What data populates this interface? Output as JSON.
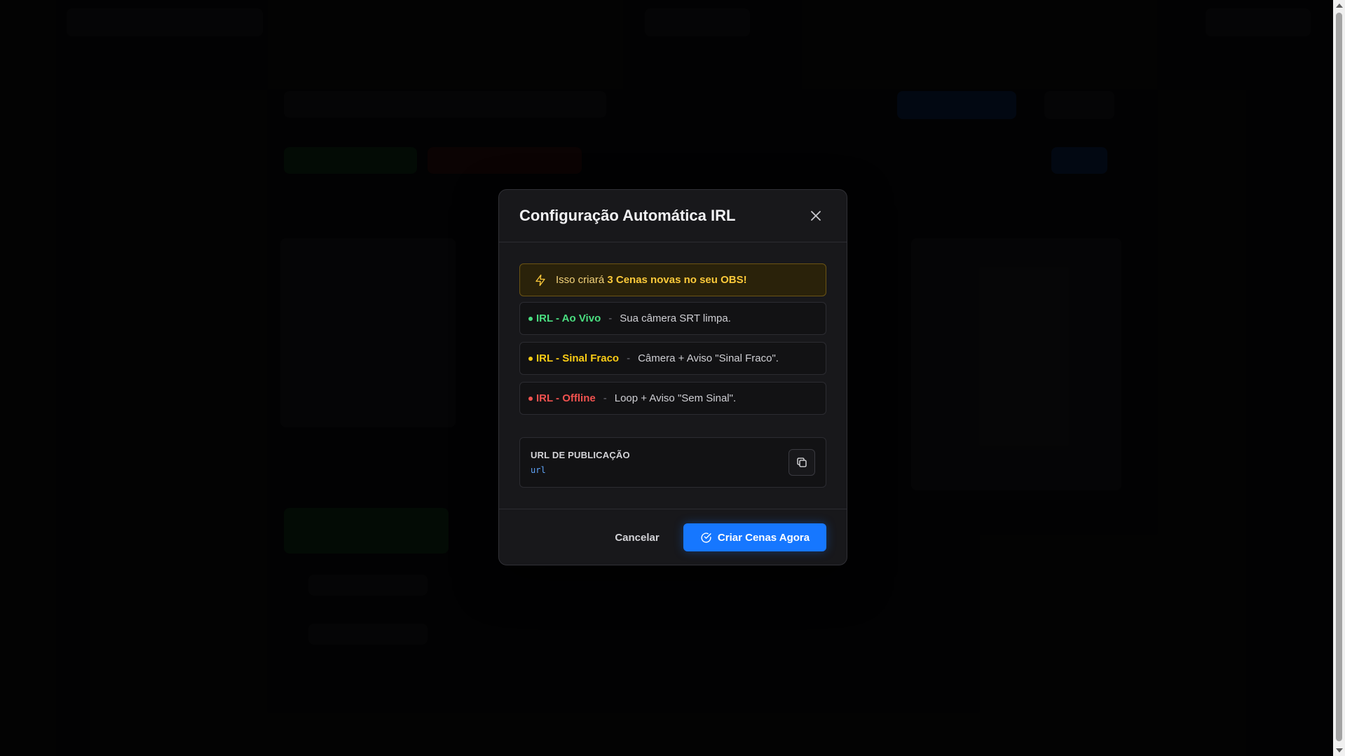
{
  "colors": {
    "accent": "#1677ff",
    "live": "#4ade80",
    "weak": "#facc15",
    "offline": "#f0524f",
    "warning_bg": "#2a220a",
    "warning_text": "#fcc93a"
  },
  "modal": {
    "title": "Configuração Automática IRL",
    "close_icon": "close-icon",
    "warning": {
      "icon": "lightning-icon",
      "text_before": "Isso criará",
      "text_strong": "3 Cenas novas no seu OBS!"
    },
    "scenes": [
      {
        "name": "IRL - Ao Vivo",
        "separator": "-",
        "description": "Sua câmera SRT limpa.",
        "status": "live"
      },
      {
        "name": "IRL - Sinal Fraco",
        "separator": "-",
        "description": "Câmera + Aviso \"Sinal Fraco\".",
        "status": "weak"
      },
      {
        "name": "IRL - Offline",
        "separator": "-",
        "description": "Loop + Aviso \"Sem Sinal\".",
        "status": "offline"
      }
    ],
    "url": {
      "label": "URL DE PUBLICAÇÃO",
      "value": "url",
      "copy_icon": "copy-icon"
    },
    "footer": {
      "cancel_label": "Cancelar",
      "confirm_label": "Criar Cenas Agora",
      "confirm_icon": "check-circle-icon"
    }
  }
}
